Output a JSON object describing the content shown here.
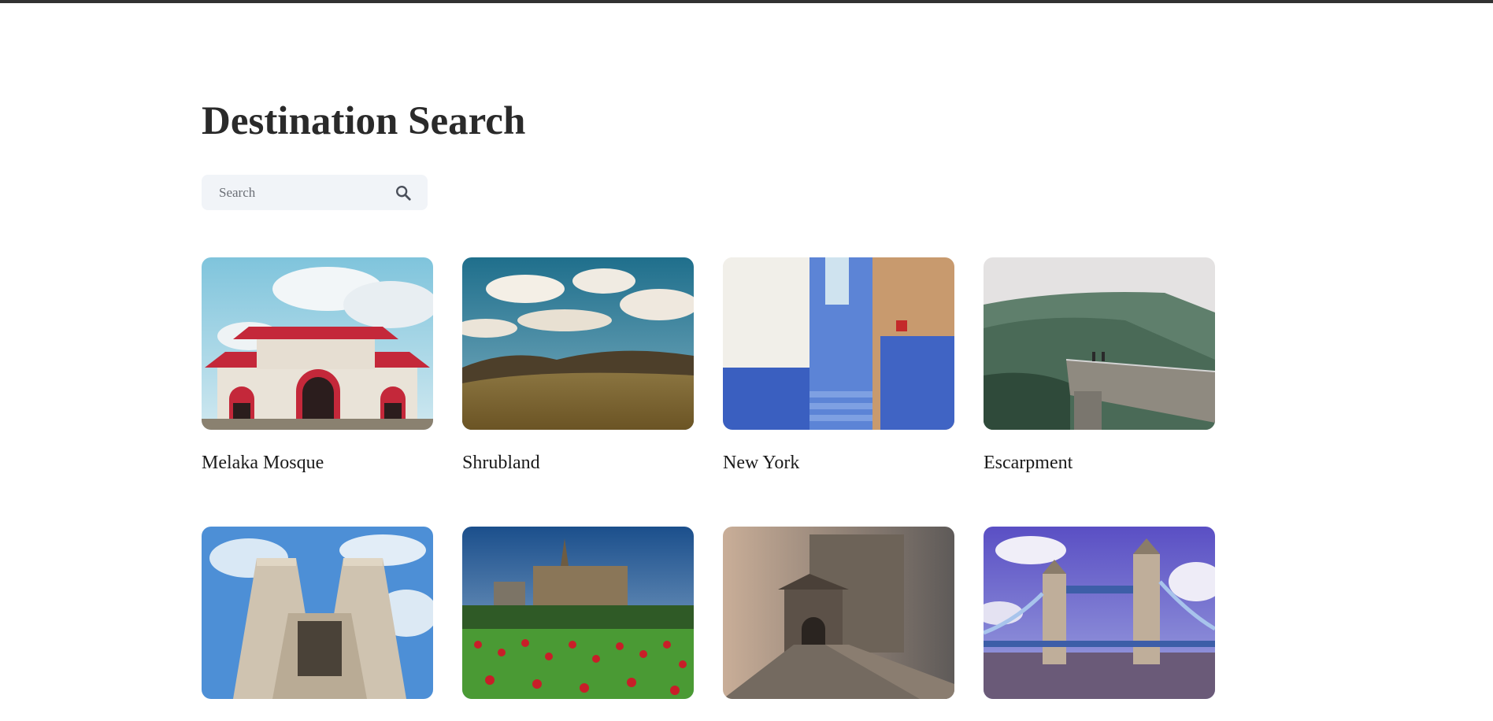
{
  "page": {
    "title": "Destination Search"
  },
  "search": {
    "placeholder": "Search",
    "value": "",
    "icon": "search-icon"
  },
  "destinations": [
    {
      "name": "Melaka Mosque",
      "image": "red-pagoda-mosque"
    },
    {
      "name": "Shrubland",
      "image": "grassland-under-clouds"
    },
    {
      "name": "New York",
      "image": "blue-alley-stairs"
    },
    {
      "name": "Escarpment",
      "image": "cliff-viewpoint"
    },
    {
      "name": "",
      "image": "gothic-abbey"
    },
    {
      "name": "",
      "image": "cathedral-tulip-field"
    },
    {
      "name": "",
      "image": "misty-castle-bridge"
    },
    {
      "name": "",
      "image": "tower-bridge"
    }
  ]
}
